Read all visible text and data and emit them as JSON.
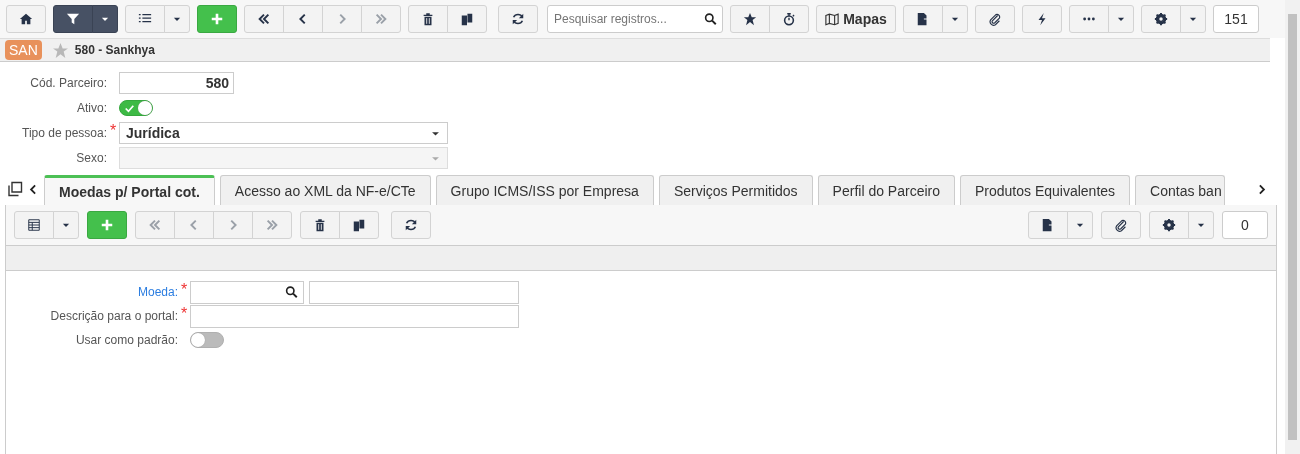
{
  "toolbar": {
    "filter_active": true,
    "navigation": [
      {
        "disabled": false
      },
      {
        "disabled": false
      },
      {
        "disabled": true
      },
      {
        "disabled": true
      }
    ],
    "search": {
      "placeholder": "Pesquisar registros..."
    },
    "maps_button": "Mapas",
    "record_count": "151"
  },
  "record": {
    "badge": "SAN",
    "favorite": false,
    "title": "580 - Sankhya"
  },
  "form": {
    "fields": [
      {
        "kind": "number",
        "label": "Cód. Parceiro:",
        "value": "580"
      },
      {
        "kind": "toggle",
        "label": "Ativo:",
        "on": true
      },
      {
        "kind": "select",
        "label": "Tipo de pessoa:",
        "required_mark": "*",
        "value": "Jurídica",
        "disabled": false
      },
      {
        "kind": "select",
        "label": "Sexo:",
        "disabled": true
      }
    ]
  },
  "tabs": [
    {
      "label": "Moedas p/ Portal cot.",
      "selected": true
    },
    {
      "label": "Acesso ao XML da NF-e/CTe",
      "selected": false
    },
    {
      "label": "Grupo ICMS/ISS por Empresa",
      "selected": false
    },
    {
      "label": "Serviços Permitidos",
      "selected": false
    },
    {
      "label": "Perfil do Parceiro",
      "selected": false
    },
    {
      "label": "Produtos Equivalentes",
      "selected": false
    },
    {
      "label": "Contas ban",
      "selected": false
    }
  ],
  "detail": {
    "toolbar": {
      "navigation": [
        {
          "disabled": true
        },
        {
          "disabled": true
        },
        {
          "disabled": true
        },
        {
          "disabled": true
        }
      ],
      "record_count": "0"
    },
    "fields": [
      {
        "kind": "lookup",
        "label": "Moeda:",
        "link": true,
        "required_mark": "*"
      },
      {
        "kind": "text",
        "label": "Descrição para o portal:",
        "link": false,
        "required_mark": "*"
      },
      {
        "kind": "toggle",
        "label": "Usar como padrão:",
        "link": false,
        "on": false
      }
    ]
  }
}
